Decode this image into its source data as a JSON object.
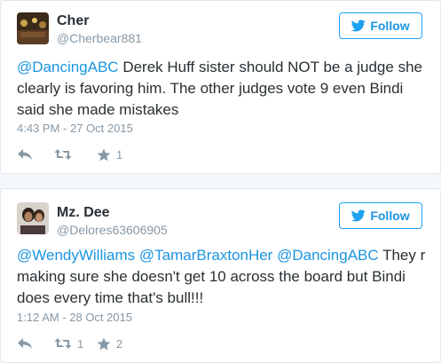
{
  "colors": {
    "accent": "#1da1f2",
    "link": "#1b95e0",
    "muted": "#8899a6",
    "text": "#292f33"
  },
  "tweets": [
    {
      "name": "Cher",
      "handle": "@Cherbear881",
      "follow_label": "Follow",
      "text_parts": [
        {
          "t": "@DancingABC",
          "mention": true
        },
        {
          "t": "  Derek Huff sister should NOT be a judge she clearly is favoring him. The other judges vote 9  even Bindi said she made mistakes",
          "mention": false
        }
      ],
      "timestamp": "4:43 PM - 27 Oct 2015",
      "retweets": "",
      "likes": "1",
      "icons": [
        "reply-icon",
        "retweet-icon",
        "like-icon"
      ]
    },
    {
      "name": "Mz. Dee",
      "handle": "@Delores63606905",
      "follow_label": "Follow",
      "text_parts": [
        {
          "t": "@WendyWilliams",
          "mention": true
        },
        {
          "t": " ",
          "mention": false
        },
        {
          "t": "@TamarBraxtonHer",
          "mention": true
        },
        {
          "t": " ",
          "mention": false
        },
        {
          "t": "@DancingABC",
          "mention": true
        },
        {
          "t": " They r making sure she doesn't get 10 across the board but Bindi does every time that's bull!!!",
          "mention": false
        }
      ],
      "timestamp": "1:12 AM - 28 Oct 2015",
      "retweets": "1",
      "likes": "2",
      "icons": [
        "reply-icon",
        "retweet-icon",
        "like-icon"
      ]
    }
  ]
}
